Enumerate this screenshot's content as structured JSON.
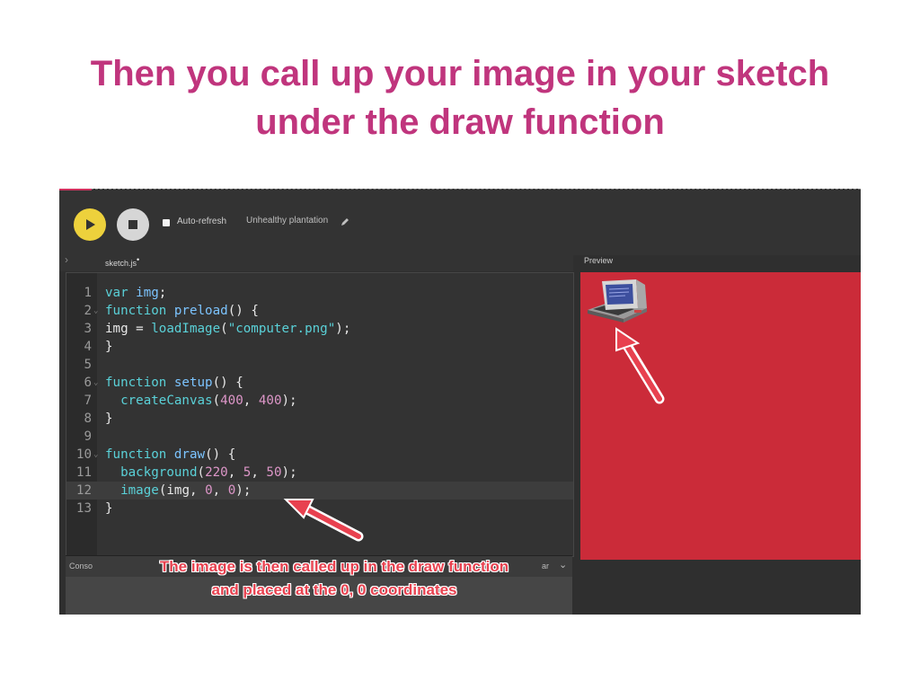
{
  "slide": {
    "title_line1": "Then you call up your image in your sketch",
    "title_line2": "under the draw function",
    "title_color": "#c0357d"
  },
  "editor_app": {
    "toolbar": {
      "play_icon": "play-icon",
      "stop_icon": "stop-icon",
      "auto_refresh_label": "Auto-refresh",
      "auto_refresh_checked": false,
      "sketch_name": "Unhealthy plantation",
      "edit_icon": "pencil-icon",
      "play_color": "#edd13c"
    },
    "file_tab": {
      "name": "sketch.js",
      "modified_marker": "•"
    },
    "preview": {
      "label": "Preview",
      "canvas_color": "#cb2b39",
      "image_icon": "computer-icon"
    },
    "code_lines": [
      {
        "n": "1",
        "text": "var img;"
      },
      {
        "n": "2",
        "text": "function preload() {"
      },
      {
        "n": "3",
        "text": "img = loadImage(\"computer.png\");"
      },
      {
        "n": "4",
        "text": "}"
      },
      {
        "n": "5",
        "text": ""
      },
      {
        "n": "6",
        "text": "function setup() {"
      },
      {
        "n": "7",
        "text": "  createCanvas(400, 400);"
      },
      {
        "n": "8",
        "text": "}"
      },
      {
        "n": "9",
        "text": ""
      },
      {
        "n": "10",
        "text": "function draw() {"
      },
      {
        "n": "11",
        "text": "  background(220, 5, 50);"
      },
      {
        "n": "12",
        "text": "  image(img, 0, 0);"
      },
      {
        "n": "13",
        "text": "}"
      }
    ],
    "console": {
      "label": "Conso",
      "clear_label": "ar"
    }
  },
  "annotation": {
    "line1": "The image is then called up in the draw function",
    "line2": "and placed at the 0, 0 coordinates",
    "color": "#e8414f"
  }
}
